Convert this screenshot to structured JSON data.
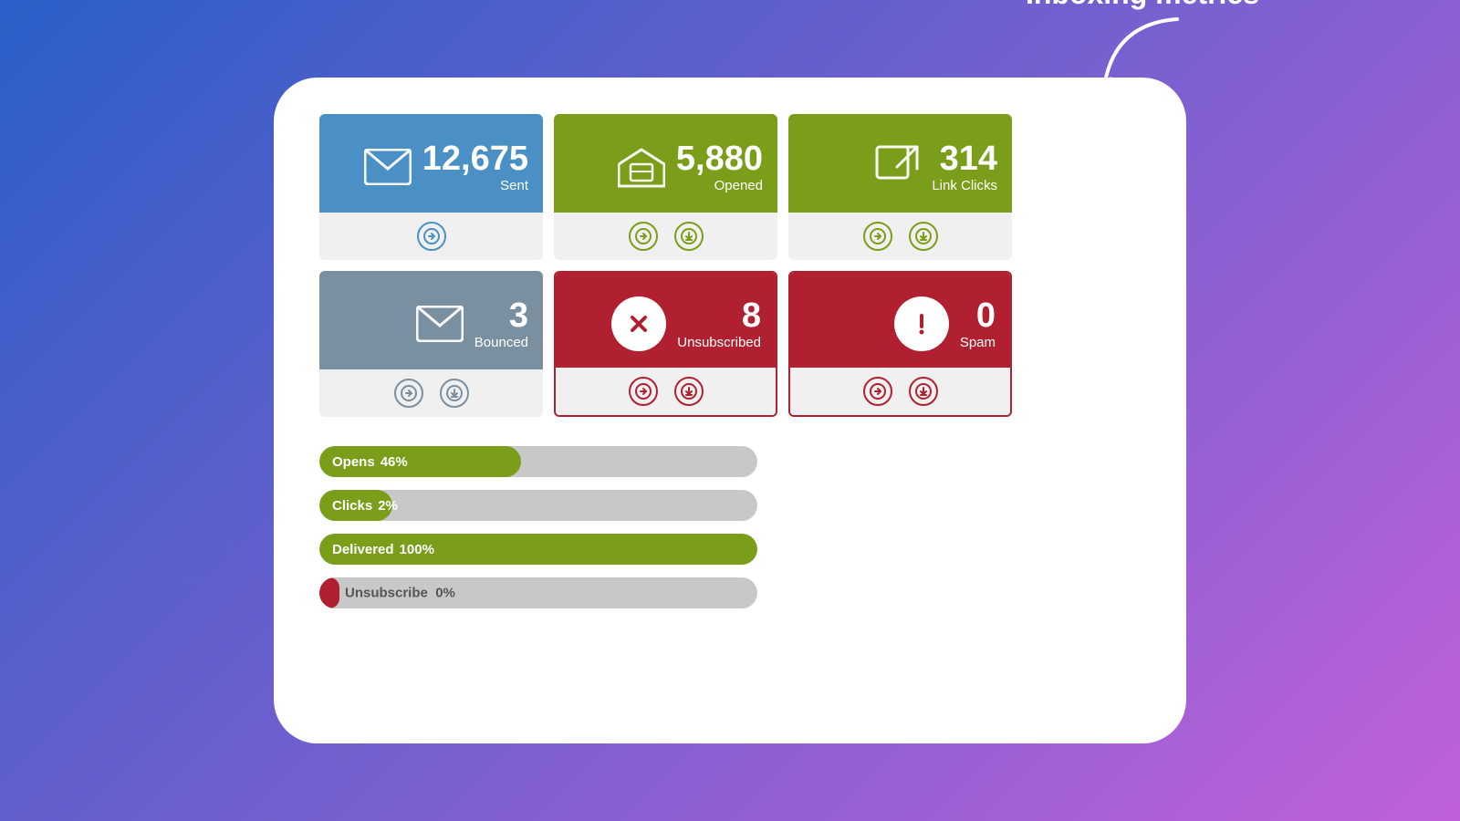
{
  "annotation": {
    "label": "Inboxing metrics"
  },
  "metrics": [
    {
      "id": "sent",
      "value": "12,675",
      "label": "Sent",
      "color": "blue",
      "icon": "envelope",
      "actions": [
        "arrow",
        null
      ]
    },
    {
      "id": "opened",
      "value": "5,880",
      "label": "Opened",
      "color": "olive",
      "icon": "envelope-open",
      "actions": [
        "arrow",
        "download"
      ]
    },
    {
      "id": "link-clicks",
      "value": "314",
      "label": "Link Clicks",
      "color": "olive",
      "icon": "link",
      "actions": [
        "arrow",
        "download"
      ]
    },
    {
      "id": "bounced",
      "value": "3",
      "label": "Bounced",
      "color": "gray",
      "icon": "envelope",
      "actions": [
        "arrow",
        "download"
      ]
    },
    {
      "id": "unsubscribed",
      "value": "8",
      "label": "Unsubscribed",
      "color": "red",
      "icon": "circle-x",
      "actions": [
        "arrow",
        "download"
      ]
    },
    {
      "id": "spam",
      "value": "0",
      "label": "Spam",
      "color": "red",
      "icon": "exclamation",
      "actions": [
        "arrow",
        "download"
      ]
    }
  ],
  "progress_bars": [
    {
      "id": "opens",
      "label": "Opens",
      "percent": 46,
      "fill": "olive"
    },
    {
      "id": "clicks",
      "label": "Clicks",
      "percent": 2,
      "fill": "olive"
    },
    {
      "id": "delivered",
      "label": "Delivered",
      "percent": 100,
      "fill": "olive"
    },
    {
      "id": "unsubscribe",
      "label": "Unsubscribe",
      "percent": 0,
      "fill": "red"
    }
  ]
}
